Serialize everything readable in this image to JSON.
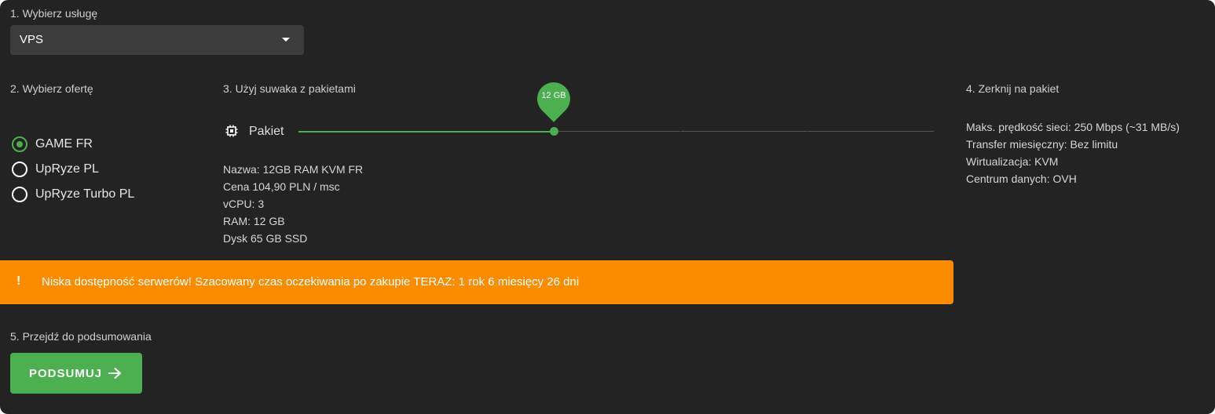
{
  "step1": {
    "label": "1. Wybierz usługę",
    "selected": "VPS"
  },
  "step2": {
    "label": "2. Wybierz ofertę",
    "options": [
      {
        "label": "GAME FR",
        "checked": true
      },
      {
        "label": "UpRyze PL",
        "checked": false
      },
      {
        "label": "UpRyze Turbo PL",
        "checked": false
      }
    ]
  },
  "step3": {
    "label": "3. Użyj suwaka z pakietami",
    "slider_label": "Pakiet",
    "value_badge": "12 GB",
    "slider_fraction": 0.402,
    "details": [
      "Nazwa: 12GB RAM KVM FR",
      "Cena 104,90 PLN / msc",
      "vCPU: 3",
      "RAM: 12 GB",
      "Dysk 65 GB SSD"
    ]
  },
  "step4": {
    "label": "4. Zerknij na pakiet",
    "lines": [
      "Maks. prędkość sieci: 250 Mbps (~31 MB/s)",
      "Transfer miesięczny: Bez limitu",
      "Wirtualizacja: KVM",
      "Centrum danych: OVH"
    ]
  },
  "alert": {
    "icon": "!",
    "text": "Niska dostępność serwerów! Szacowany czas oczekiwania po zakupie TERAZ: 1 rok 6 miesięcy 26 dni"
  },
  "step5": {
    "label": "5. Przejdź do podsumowania",
    "button": "PODSUMUJ"
  },
  "colors": {
    "accent": "#4caf50",
    "warning": "#fb8c00",
    "panel": "#232323"
  }
}
